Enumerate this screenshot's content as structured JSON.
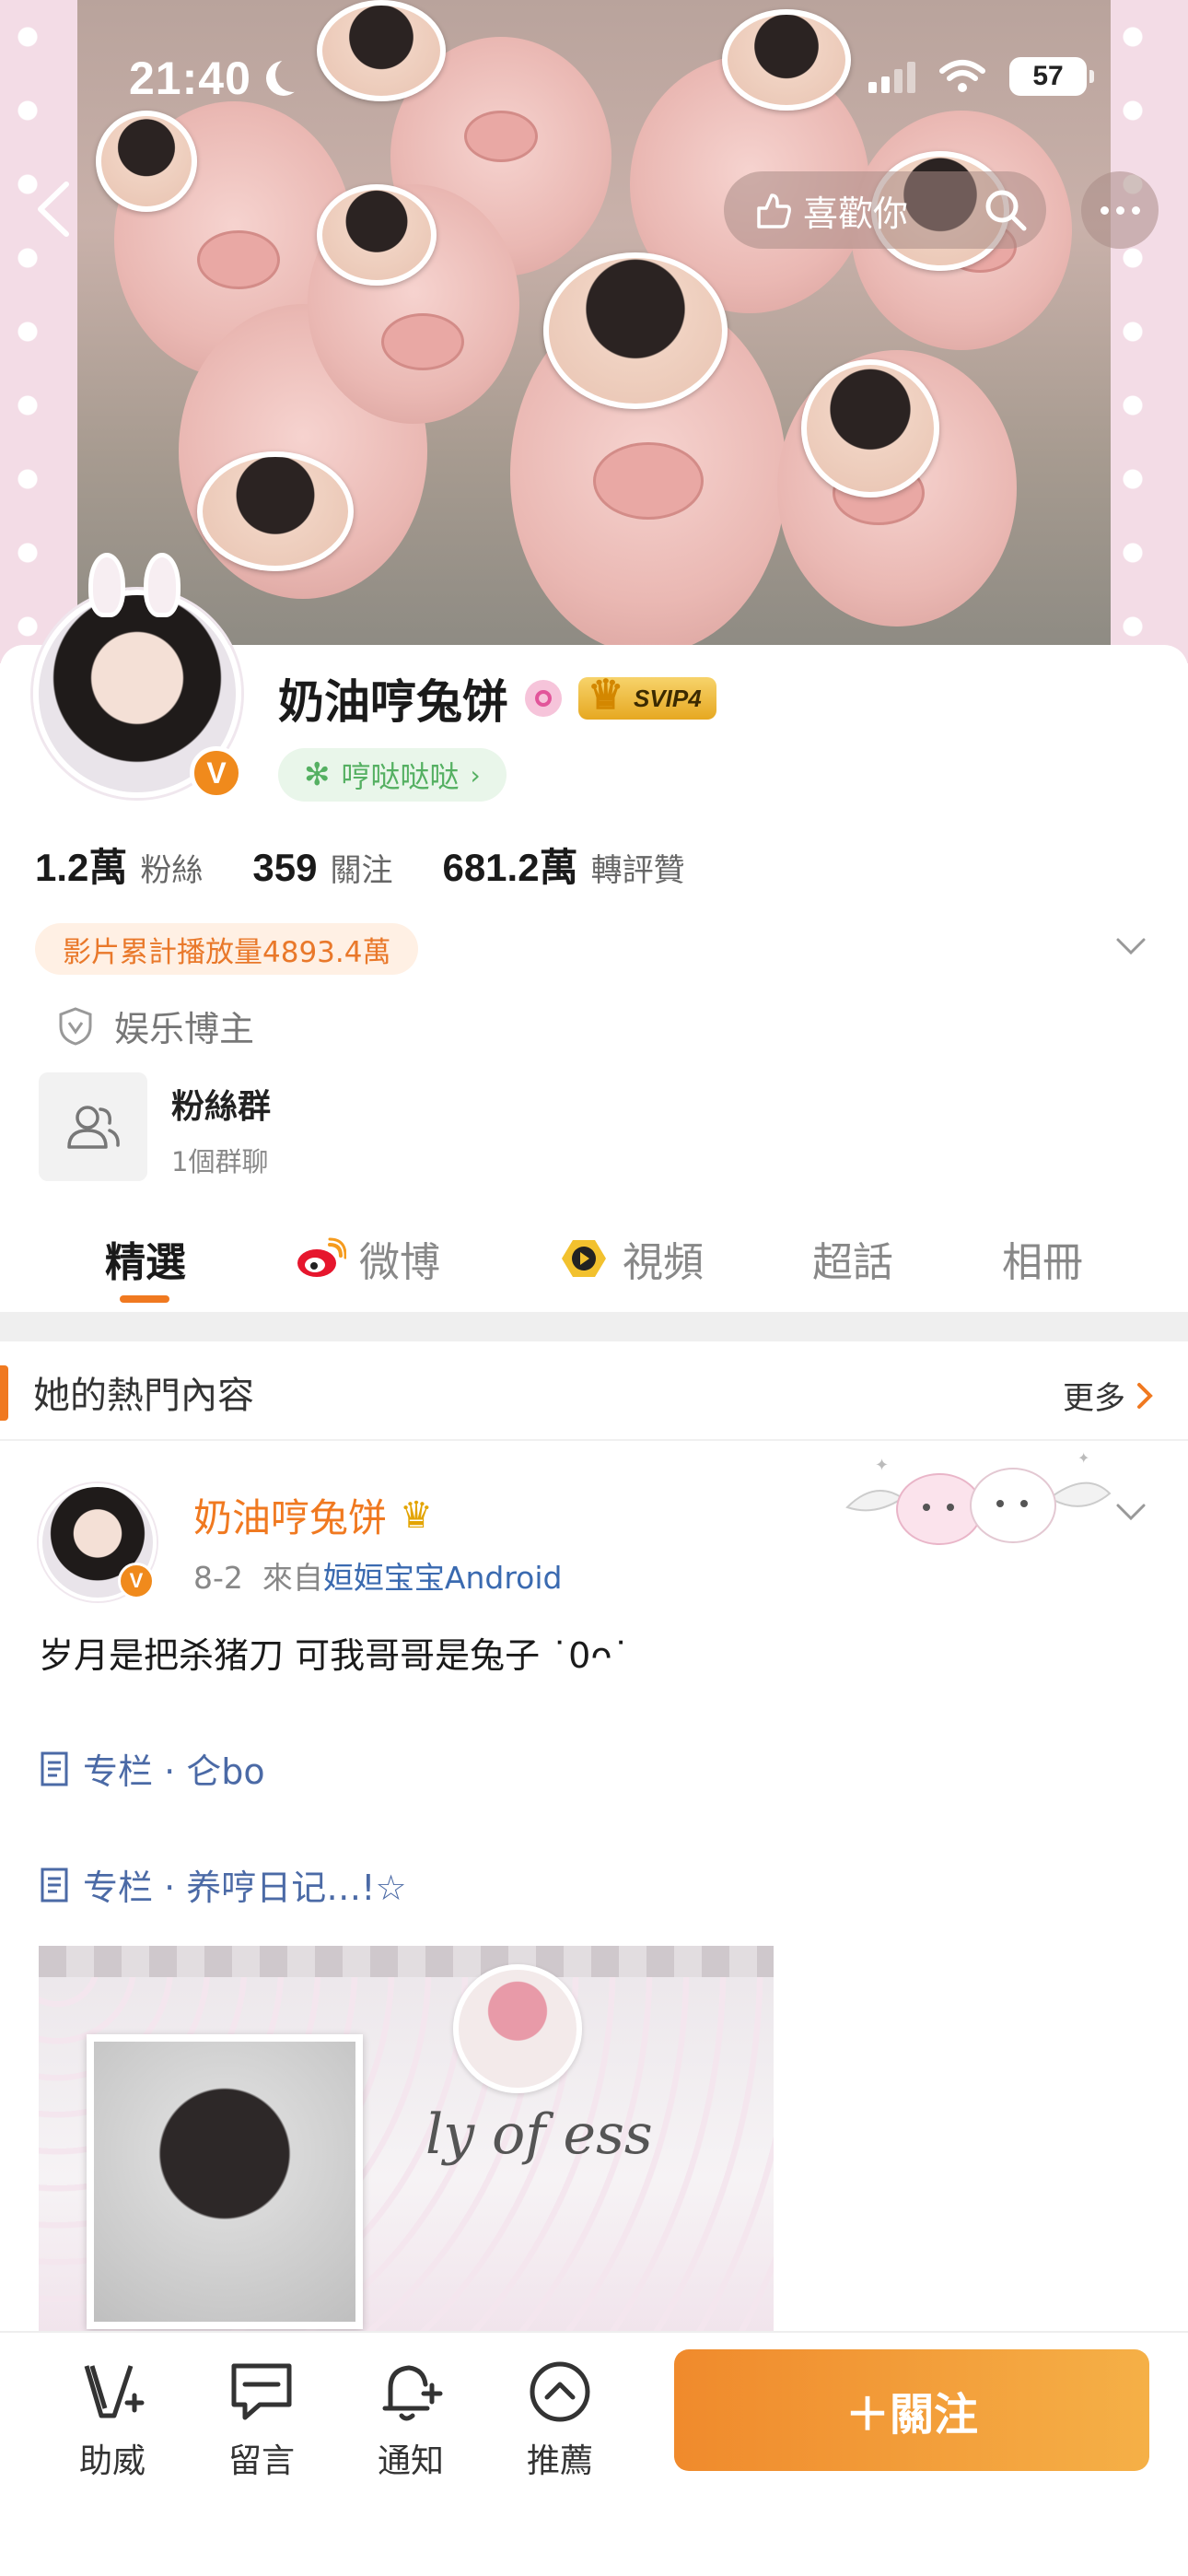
{
  "status_bar": {
    "time": "21:40",
    "battery": "57"
  },
  "header": {
    "like_label": "喜歡你"
  },
  "profile": {
    "name": "奶油哼兔饼",
    "vip_badge": "SVIP4",
    "tag": "哼哒哒哒",
    "stats": [
      {
        "num": "1.2萬",
        "label": "粉絲"
      },
      {
        "num": "359",
        "label": "關注"
      },
      {
        "num": "681.2萬",
        "label": "轉評贊"
      }
    ],
    "play_count": "影片累計播放量4893.4萬",
    "role": "娱乐博主",
    "fan_group": {
      "title": "粉絲群",
      "subtitle": "1個群聊"
    }
  },
  "tabs": [
    {
      "label": "精選",
      "active": true
    },
    {
      "label": "微博"
    },
    {
      "label": "視頻"
    },
    {
      "label": "超話"
    },
    {
      "label": "相冊"
    }
  ],
  "hot": {
    "title": "她的熱門內容",
    "more": "更多"
  },
  "post": {
    "author": "奶油哼兔饼",
    "date": "8-2",
    "from_prefix": "來自",
    "source": "姮姮宝宝Android",
    "text": "岁月是把杀猪刀 可我哥哥是兔子 ˙0ᴖ˙",
    "links": [
      "专栏 · 仑bo",
      "专栏 · 养哼日记…!☆"
    ],
    "image_script": "ly of ess"
  },
  "bottom_bar": {
    "items": [
      "助威",
      "留言",
      "通知",
      "推薦"
    ],
    "follow": "＋關注"
  },
  "colors": {
    "accent": "#f07920",
    "link": "#4b6aa6",
    "tag_green": "#55b062"
  }
}
